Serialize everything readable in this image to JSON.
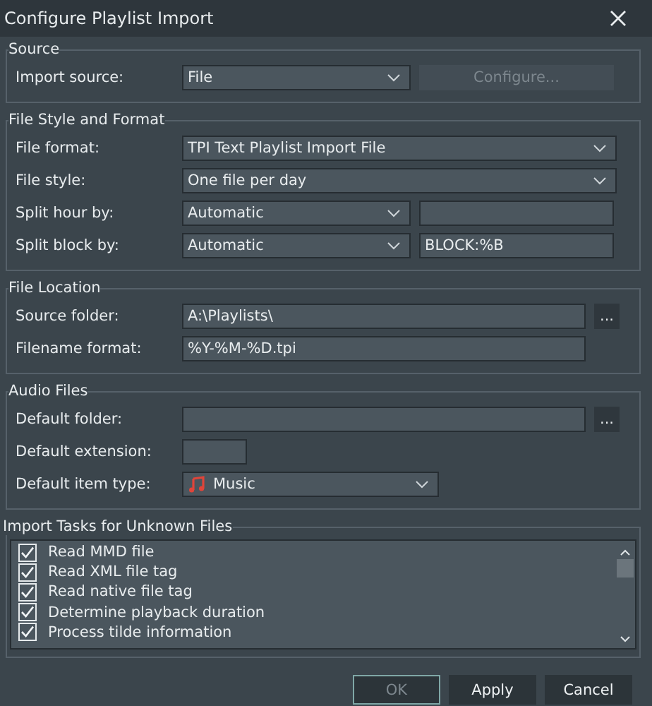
{
  "window": {
    "title": "Configure Playlist Import"
  },
  "groups": [
    {
      "title": "Source",
      "rows": [
        {
          "label": "Import source:",
          "kind": "select-button",
          "value": "File",
          "button": {
            "label": "Configure...",
            "disabled": true
          }
        }
      ]
    },
    {
      "title": "File Style and Format",
      "rows": [
        {
          "label": "File format:",
          "kind": "select-wide",
          "value": "TPI Text Playlist Import File"
        },
        {
          "label": "File style:",
          "kind": "select-wide",
          "value": "One file per day"
        },
        {
          "label": "Split hour by:",
          "kind": "select-input",
          "value": "Automatic",
          "extra": ""
        },
        {
          "label": "Split block by:",
          "kind": "select-input",
          "value": "Automatic",
          "extra": "BLOCK:%B"
        }
      ]
    },
    {
      "title": "File Location",
      "rows": [
        {
          "label": "Source folder:",
          "kind": "input-browse",
          "value": "A:\\Playlists\\",
          "button": {
            "label": "..."
          }
        },
        {
          "label": "Filename format:",
          "kind": "input",
          "value": "%Y-%M-%D.tpi"
        }
      ]
    },
    {
      "title": "Audio Files",
      "rows": [
        {
          "label": "Default folder:",
          "kind": "input-browse",
          "value": "",
          "button": {
            "label": "..."
          }
        },
        {
          "label": "Default extension:",
          "kind": "input-short",
          "value": ""
        },
        {
          "label": "Default item type:",
          "kind": "select-icon",
          "value": "Music"
        }
      ]
    }
  ],
  "tasks": {
    "title": "Import Tasks for Unknown Files",
    "items": [
      {
        "label": "Read MMD file",
        "checked": true
      },
      {
        "label": "Read XML file tag",
        "checked": true
      },
      {
        "label": "Read native file tag",
        "checked": true
      },
      {
        "label": "Determine playback duration",
        "checked": true
      },
      {
        "label": "Process tilde information",
        "checked": true
      }
    ]
  },
  "buttons": [
    {
      "label": "OK",
      "disabled": true
    },
    {
      "label": "Apply",
      "disabled": false
    },
    {
      "label": "Cancel",
      "disabled": false
    }
  ]
}
